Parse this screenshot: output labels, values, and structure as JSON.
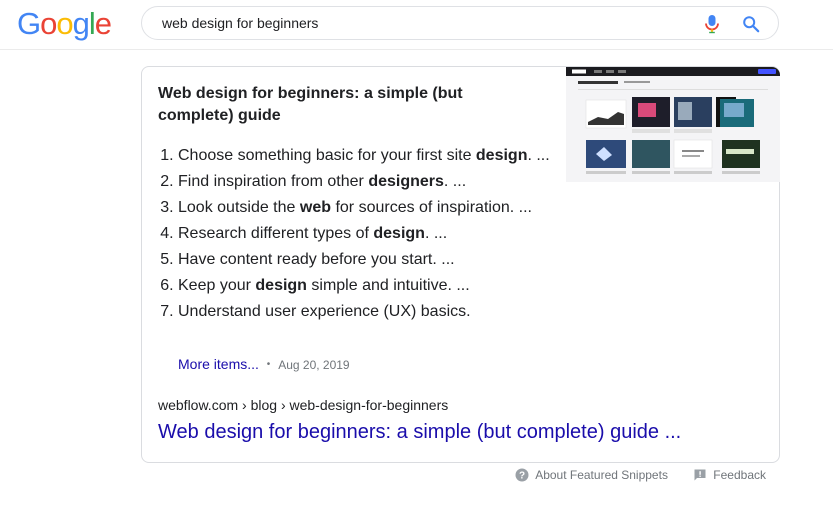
{
  "logo": {
    "letters": [
      "G",
      "o",
      "o",
      "g",
      "l",
      "e"
    ],
    "colors": [
      "#4285f4",
      "#ea4335",
      "#fbbc05",
      "#4285f4",
      "#34a853",
      "#ea4335"
    ]
  },
  "search": {
    "query": "web design for beginners",
    "mic_icon": "microphone-icon",
    "search_icon": "magnifier-icon"
  },
  "snippet": {
    "title": "Web design for beginners: a simple (but complete) guide",
    "steps": [
      [
        {
          "t": "Choose something basic for your first site "
        },
        {
          "t": "design",
          "b": true
        },
        {
          "t": ". ..."
        }
      ],
      [
        {
          "t": "Find inspiration from other "
        },
        {
          "t": "designers",
          "b": true
        },
        {
          "t": ". ..."
        }
      ],
      [
        {
          "t": "Look outside the "
        },
        {
          "t": "web",
          "b": true
        },
        {
          "t": " for sources of inspiration. ..."
        }
      ],
      [
        {
          "t": "Research different types of "
        },
        {
          "t": "design",
          "b": true
        },
        {
          "t": ". ..."
        }
      ],
      [
        {
          "t": "Have content ready before you start. ..."
        }
      ],
      [
        {
          "t": "Keep your "
        },
        {
          "t": "design",
          "b": true
        },
        {
          "t": " simple and intuitive. ..."
        }
      ],
      [
        {
          "t": "Understand user experience (UX) basics."
        }
      ]
    ],
    "more_items": "More items...",
    "separator": "•",
    "date": "Aug 20, 2019",
    "cite": "webflow.com › blog › web-design-for-beginners",
    "link_text": "Web design for beginners: a simple (but complete) guide ..."
  },
  "footer": {
    "about_label": "About Featured Snippets",
    "about_icon": "help-circle-icon",
    "feedback_label": "Feedback",
    "feedback_icon": "feedback-icon"
  },
  "colors": {
    "link": "#1a0dab",
    "meta": "#70757a",
    "mic_red": "#ea4335",
    "mic_blue": "#4285f4"
  }
}
